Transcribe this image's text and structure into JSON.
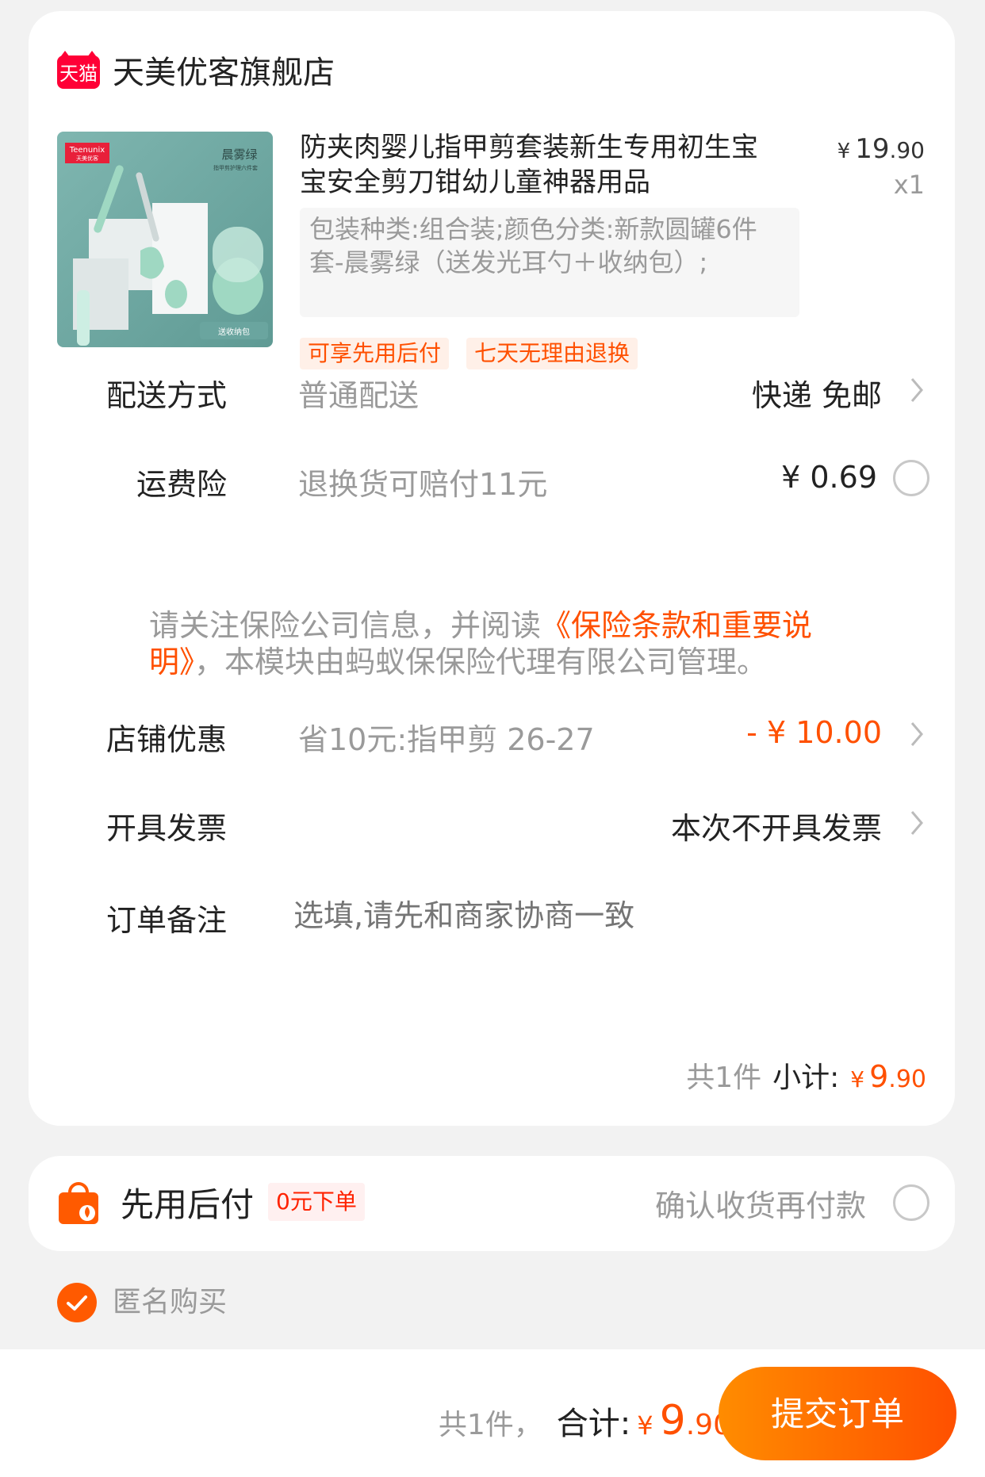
{
  "shop": {
    "platform_badge": "天猫",
    "name": "天美优客旗舰店"
  },
  "product": {
    "image_brand": "Teenunix",
    "image_brand_sub": "天美优客",
    "image_color": "晨雾绿",
    "image_sub": "指甲剪护理六件套",
    "image_tag": "送收纳包",
    "title": "防夹肉婴儿指甲剪套装新生专用初生宝宝安全剪刀钳幼儿童神器用品",
    "price_symbol": "¥",
    "price_int": "19",
    "price_dec": ".90",
    "quantity": "x1",
    "sku": "包装种类:组合装;颜色分类:新款圆罐6件套-晨雾绿（送发光耳勺＋收纳包）;",
    "tags": [
      "可享先用后付",
      "七天无理由退换"
    ]
  },
  "delivery": {
    "label": "配送方式",
    "desc": "普通配送",
    "value": "快递 免邮"
  },
  "insurance": {
    "label": "运费险",
    "desc": "退换货可赔付11元",
    "value": "¥ 0.69",
    "notice_pre": "请关注保险公司信息，并阅读",
    "notice_link": "《保险条款和重要说明》",
    "notice_post": "，本模块由蚂蚁保保险代理有限公司管理。"
  },
  "discount": {
    "label": "店铺优惠",
    "desc": "省10元:指甲剪 26-27",
    "value": "- ¥ 10.00"
  },
  "invoice": {
    "label": "开具发票",
    "value": "本次不开具发票"
  },
  "remark": {
    "label": "订单备注",
    "placeholder": "选填,请先和商家协商一致"
  },
  "subtotal": {
    "count": "共1件",
    "label": "小计:",
    "symbol": "¥",
    "int": "9",
    "dec": ".90"
  },
  "pay_later": {
    "title": "先用后付",
    "tag": "0元下单",
    "desc": "确认收货再付款"
  },
  "anonymous": {
    "label": "匿名购买",
    "checked": true
  },
  "bottom": {
    "count": "共1件，",
    "label": "合计:",
    "symbol": "¥",
    "int": "9",
    "dec": ".90",
    "submit": "提交订单"
  },
  "colors": {
    "accent": "#ff5000",
    "tmall_red": "#ff0036",
    "product_green": "#9fd8c2"
  }
}
